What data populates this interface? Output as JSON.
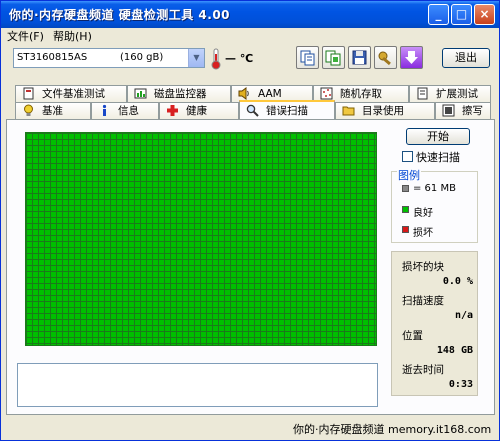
{
  "title_bar": {
    "title": "你的·内存硬盘频道 硬盘检测工具 4.00",
    "minimize": "_",
    "maximize": "□",
    "close": "×"
  },
  "menu": {
    "file": "文件(F)",
    "help": "帮助(H)"
  },
  "toolbar": {
    "drive_model": "ST3160815AS",
    "drive_size": "(160 gB)",
    "temperature": "— ℃",
    "exit_label": "退出"
  },
  "tabs_top": [
    {
      "label": "文件基准测试",
      "icon": "file-benchmark-icon"
    },
    {
      "label": "磁盘监控器",
      "icon": "disk-monitor-icon"
    },
    {
      "label": "AAM",
      "icon": "speaker-icon"
    },
    {
      "label": "随机存取",
      "icon": "random-access-icon"
    },
    {
      "label": "扩展测试",
      "icon": "extended-test-icon"
    }
  ],
  "tabs_bottom": [
    {
      "label": "基准",
      "icon": "bulb-icon"
    },
    {
      "label": "信息",
      "icon": "info-icon"
    },
    {
      "label": "健康",
      "icon": "health-cross-icon"
    },
    {
      "label": "错误扫描",
      "icon": "magnifier-icon"
    },
    {
      "label": "目录使用",
      "icon": "folder-icon"
    },
    {
      "label": "擦写",
      "icon": "erase-icon"
    }
  ],
  "error_scan": {
    "start_label": "开始",
    "quick_scan_label": "快速扫描",
    "legend_title": "图例",
    "legend": {
      "block_size": "= 61 MB",
      "good": "良好",
      "damaged": "损坏"
    },
    "stats": {
      "damaged_blocks_label": "损坏的块",
      "damaged_blocks_value": "0.0 %",
      "scan_speed_label": "扫描速度",
      "scan_speed_value": "n/a",
      "position_label": "位置",
      "position_value": "148 GB",
      "elapsed_label": "逝去时间",
      "elapsed_value": "0:33"
    }
  },
  "colors": {
    "good": "#00c000",
    "damaged": "#d81818",
    "block": "#888888",
    "title_bar": "#0054e3"
  },
  "footer": "你的·内存硬盘频道  memory.it168.com"
}
